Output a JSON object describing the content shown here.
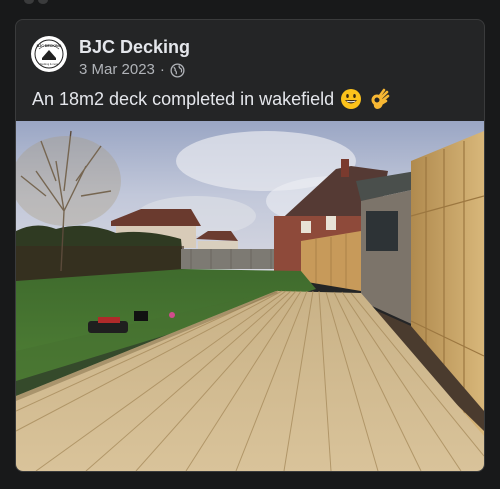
{
  "post": {
    "page_name": "BJC Decking",
    "date": "3 Mar 2023",
    "separator": "·",
    "audience_icon": "globe-icon",
    "text": "An 18m2 deck completed in wakefield",
    "emojis": [
      "smiling-face-icon",
      "ok-hand-icon"
    ],
    "avatar_logo_text": "BJC DECKING",
    "avatar_logo_subtext": "Decking & more"
  },
  "colors": {
    "background": "#18191a",
    "card": "#242526",
    "primary_text": "#e4e6eb",
    "secondary_text": "#b0b3b8"
  }
}
